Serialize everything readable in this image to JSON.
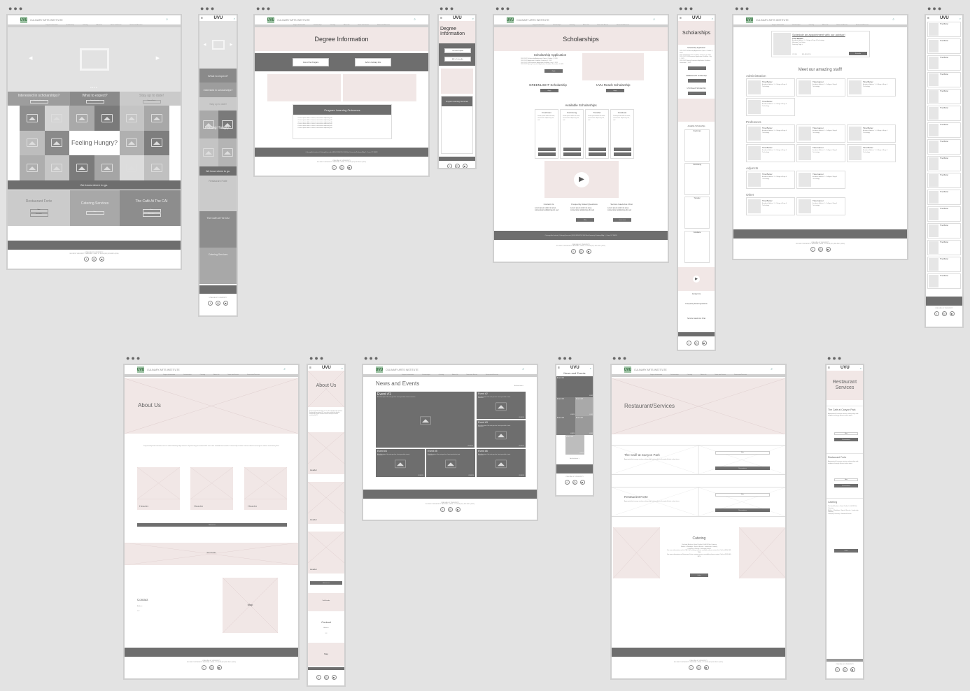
{
  "brand": {
    "logo_text": "UVU",
    "site_title": "CULINARY ARTS INSTITUTE",
    "nav_items": [
      "Degree Information",
      "Scholarships",
      "Catering",
      "About Us",
      "News and Events",
      "Restaurant/Services"
    ],
    "footer_text": [
      "UTAH VALLEY UNIVERSITY",
      "800 WEST UNIVERSITY PARKWAY, OREM, UT 84058 (801) 863-INFO (4636)",
      "(801) 863-INFO"
    ],
    "contact_bar": "Culinary Arts Institute | Culinary@uvu.edu | (801) 863-8074 | 800 West University Parkway Bldg. 1, Orem, UT 84058",
    "colors": {
      "pink": "#f1e7e6",
      "dark": "#6e6e6e",
      "logo_green": "#9ec3a5",
      "canvas": "#e3e3e3"
    }
  },
  "home": {
    "promo": [
      {
        "title": "Interested in scholarships?",
        "button": "Scholarship Information"
      },
      {
        "title": "What to expect?",
        "button": "Degree Information"
      },
      {
        "title": "Stay up to date!",
        "button": "News and Events"
      }
    ],
    "hero_text": "Feeling Hungry?",
    "banner": "We know where to go.",
    "services": [
      {
        "title": "Restaurant Forte",
        "buttons": [
          "Menu",
          "Reservations"
        ]
      },
      {
        "title": "Catering Services",
        "buttons": [
          "Menu"
        ]
      },
      {
        "title": "The Café At The CAI",
        "buttons": [
          "Menu",
          "Reservations"
        ]
      }
    ]
  },
  "home_mobile": {
    "promo": [
      "What to expect?",
      "Interested in scholarships?",
      "Stay up to date!"
    ],
    "hero_text": "Feeling Hungry?",
    "banner": "We know where to go.",
    "services": [
      "Restaurant Forte",
      "The Café At The CAI",
      "Catering Services"
    ]
  },
  "degree": {
    "title": "Degree Information",
    "buttons": [
      "Cost of the Program",
      "AAS in Culinary Arts"
    ],
    "outcomes_title": "Program Learning Outcomes",
    "outcomes": [
      "Lorem ipsum dolor sit amet, consectetur adipiscing elit",
      "Lorem ipsum dolor sit amet, consectetur adipiscing elit",
      "Lorem ipsum dolor sit amet, consectetur adipiscing elit",
      "Lorem ipsum dolor sit amet, consectetur adipiscing elit",
      "Lorem ipsum dolor sit amet, consectetur adipiscing elit",
      "Lorem ipsum dolor sit amet, consectetur adipiscing elit"
    ]
  },
  "scholarships": {
    "title": "Scholarships",
    "app_title": "Scholarship Application",
    "app_lines": [
      "2021-2022 Scholarship Application Opens: October 1, 2020",
      "2021-2022 Application Deadline: February 1, 2021",
      "2021-2022 Fall Semester Application Deadline: July 1, 2021",
      "2021-2022 Spring Semester Application Deadline: December 1, 2021"
    ],
    "greenlight": "GREENLIGHT Scholarship",
    "reach": "UVU Reach Scholarship",
    "available_title": "Available Scholarships",
    "types": [
      "Freshman",
      "Continuing",
      "Transfer",
      "Graduate"
    ],
    "card_text": "Lorem ipsum dolor sit amet, consectetur adipiscing elit, sed",
    "info": [
      {
        "title": "Contact Us",
        "text": "Lorem ipsum dolor sit amet, consectetur adipiscing elit, sed"
      },
      {
        "title": "Frequently Asked Questions",
        "text": "Lorem ipsum dolor sit amet, consectetur adipiscing elit, sed",
        "button": "FAQ"
      },
      {
        "title": "Service Gaels Are Chat",
        "text": "Lorem ipsum dolor sit amet, consectetur adipiscing elit, sed",
        "button": "Learn more"
      }
    ]
  },
  "staff": {
    "appointment_title": "Schedule an appointment with our advisor!",
    "advisor": {
      "name": "Tina Butter",
      "role": "Academic Advisor 1 - College of Engr & Technology",
      "extra": "Message Tina Online",
      "dept": "Directory Page >",
      "office": "CS 206",
      "phone": "801-863-8190"
    },
    "appointment_button": "Schedule",
    "heading": "Meet our amazing staff!",
    "groups": [
      {
        "name": "Administration",
        "count": 4
      },
      {
        "name": "Professors",
        "count": 6
      },
      {
        "name": "Adjuncts",
        "count": 2
      },
      {
        "name": "Other",
        "count": 2
      }
    ],
    "names": [
      "Tina Butter",
      "Tina Gamer",
      "Tina Butter"
    ]
  },
  "about": {
    "title": "About Us",
    "body": "Progressively build extensible sources without bleeding-edge initiatives. Dynamically procrastinate B2C users after installed base benefits. Dramatically visualize customer directed convergence without revolutionary ROI.",
    "headers": [
      "Header",
      "Header",
      "Header"
    ],
    "button": "Button text",
    "sub_header": "Sub Header",
    "contact_title": "Contact",
    "contact_lines": [
      "Address",
      "###"
    ],
    "map": "Map"
  },
  "news": {
    "title": "News and Events",
    "see_all": "Archive/more >",
    "events": [
      {
        "title": "Event #1",
        "date": "01/08/20"
      },
      {
        "title": "Event #2",
        "date": "01/08/20"
      },
      {
        "title": "Event #3",
        "date": "01/08/20"
      },
      {
        "title": "Event #4",
        "date": "01/08/20"
      },
      {
        "title": "Event #5",
        "date": "01/08/20"
      },
      {
        "title": "Event #6",
        "date": "01/08/20"
      }
    ],
    "desc": "A brief description of the event goes here. Lorem ipsum dolor sit amet consectetur",
    "more": "More >"
  },
  "restaurant": {
    "title": "Restaurant/Services",
    "mobile_title": "Restaurant Services",
    "places": [
      {
        "title": "The Café at Canyon Park",
        "text": "Appropriately leverage existing cutting-edge web-readiness through efficient action items.",
        "buttons": [
          "Menu",
          "Reservations"
        ]
      },
      {
        "title": "Restaurant Forte",
        "text": "Appropriately leverage existing cutting-edge web-readiness through efficient action items.",
        "buttons": [
          "Menu",
          "Reservations"
        ]
      }
    ],
    "catering_title": "Catering",
    "catering_lines": [
      "Pre-fixed Buckets • Hand Crafted • Full/Off Site Catering",
      "Buffets • Weddings • Special Events • Leadership Catering",
      "Company Catering • Seasonal Events",
      "For more information on the CAI Café catering services available, please contact the Chef at (801) 863-7504",
      "For more information on Restaurant Forte catering services available, please contact Chef at (801) 863-8074"
    ],
    "catering_button": "Order"
  }
}
